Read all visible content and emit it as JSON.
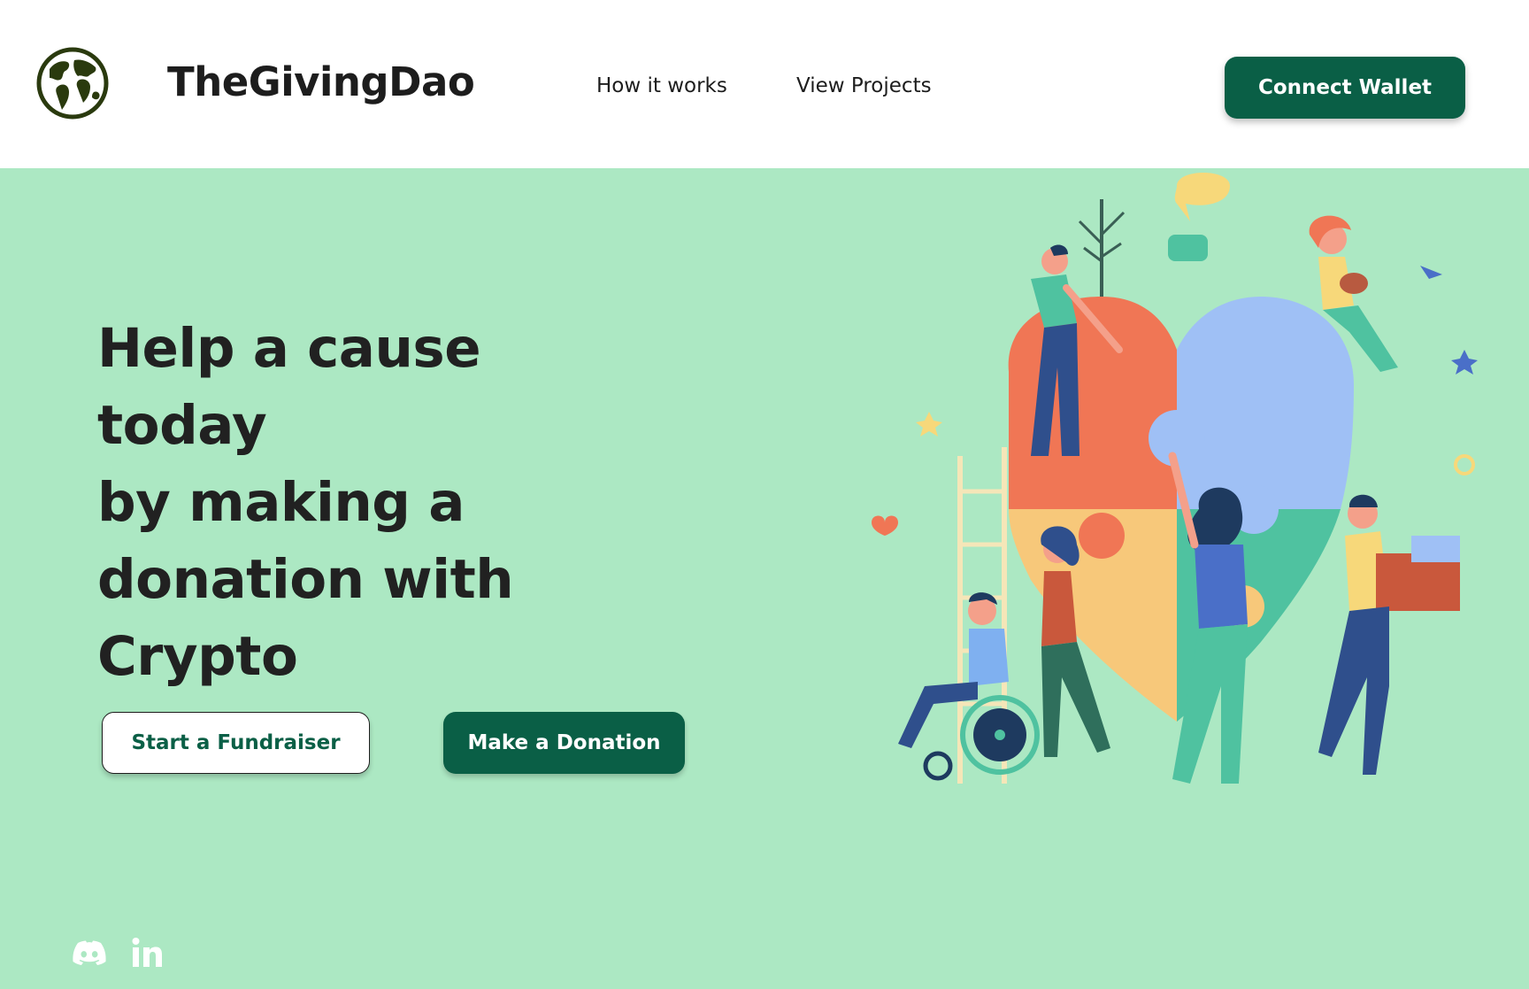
{
  "header": {
    "brand": "TheGivingDao",
    "logo_icon": "globe-icon",
    "nav": [
      {
        "label": "How it works"
      },
      {
        "label": "View Projects"
      }
    ],
    "connect_wallet_label": "Connect Wallet"
  },
  "hero": {
    "title_lines": [
      "Help a cause today",
      "by making a",
      "donation with",
      "Crypto"
    ],
    "start_fundraiser_label": "Start a Fundraiser",
    "make_donation_label": "Make a Donation",
    "illustration_icon": "puzzle-heart-people-illustration"
  },
  "social": [
    {
      "icon": "discord-icon"
    },
    {
      "icon": "linkedin-icon"
    }
  ],
  "colors": {
    "page_background": "#ace8c3",
    "header_background": "#ffffff",
    "primary": "#0a5f46",
    "text": "#1d1d1d"
  }
}
